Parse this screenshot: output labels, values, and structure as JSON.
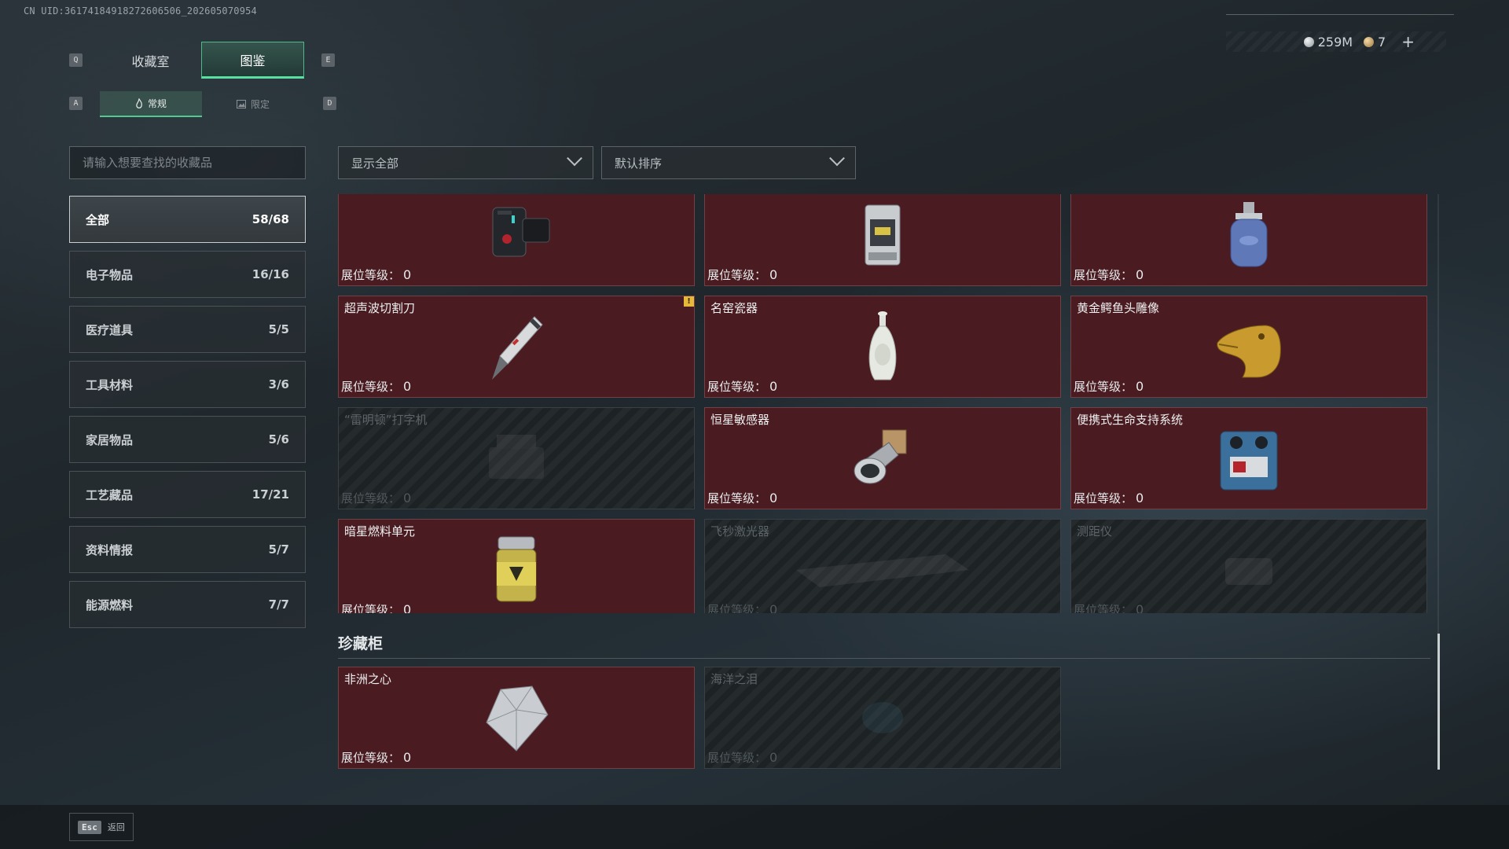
{
  "uid": "CN UID:36174184918272606506_202605070954",
  "currency": {
    "silver": "259M",
    "gold": "7",
    "plus": "+"
  },
  "keys": {
    "q": "Q",
    "e": "E",
    "a": "A",
    "d": "D",
    "esc": "Esc"
  },
  "tabs": [
    {
      "label": "收藏室",
      "active": false
    },
    {
      "label": "图鉴",
      "active": true
    }
  ],
  "subtabs": [
    {
      "label": "常规",
      "active": true
    },
    {
      "label": "限定",
      "active": false
    }
  ],
  "search": {
    "placeholder": "请输入想要查找的收藏品"
  },
  "filter": {
    "label": "显示全部"
  },
  "sort": {
    "label": "默认排序"
  },
  "categories": [
    {
      "label": "全部",
      "count": "58/68",
      "active": true
    },
    {
      "label": "电子物品",
      "count": "16/16"
    },
    {
      "label": "医疗道具",
      "count": "5/5"
    },
    {
      "label": "工具材料",
      "count": "3/6"
    },
    {
      "label": "家居物品",
      "count": "5/6"
    },
    {
      "label": "工艺藏品",
      "count": "17/21"
    },
    {
      "label": "资料情报",
      "count": "5/7"
    },
    {
      "label": "能源燃料",
      "count": "7/7"
    }
  ],
  "level_label": "展位等级：",
  "items": [
    {
      "name": "",
      "level": "0",
      "locked": false,
      "icon": "device-icon"
    },
    {
      "name": "",
      "level": "0",
      "locked": false,
      "icon": "lantern-icon"
    },
    {
      "name": "",
      "level": "0",
      "locked": false,
      "icon": "gas-canister-icon"
    },
    {
      "name": "超声波切割刀",
      "level": "0",
      "locked": false,
      "icon": "knife-icon",
      "badge": "!"
    },
    {
      "name": "名窑瓷器",
      "level": "0",
      "locked": false,
      "icon": "vase-icon"
    },
    {
      "name": "黄金鳄鱼头雕像",
      "level": "0",
      "locked": false,
      "icon": "crocodile-statue-icon"
    },
    {
      "name": "“雷明顿”打字机",
      "level": "0",
      "locked": true,
      "icon": "typewriter-icon"
    },
    {
      "name": "恒星敏感器",
      "level": "0",
      "locked": false,
      "icon": "star-sensor-icon"
    },
    {
      "name": "便携式生命支持系统",
      "level": "0",
      "locked": false,
      "icon": "life-support-icon"
    },
    {
      "name": "暗星燃料单元",
      "level": "0",
      "locked": false,
      "icon": "fuel-cell-icon"
    },
    {
      "name": "飞秒激光器",
      "level": "0",
      "locked": true,
      "icon": "laser-icon"
    },
    {
      "name": "测距仪",
      "level": "0",
      "locked": true,
      "icon": "rangefinder-icon"
    }
  ],
  "treasure": {
    "title": "珍藏柜",
    "items": [
      {
        "name": "非洲之心",
        "level": "0",
        "locked": false,
        "icon": "diamond-icon"
      },
      {
        "name": "海洋之泪",
        "level": "0",
        "locked": true,
        "icon": "gem-icon"
      }
    ]
  },
  "footer": {
    "back_label": "返回"
  }
}
